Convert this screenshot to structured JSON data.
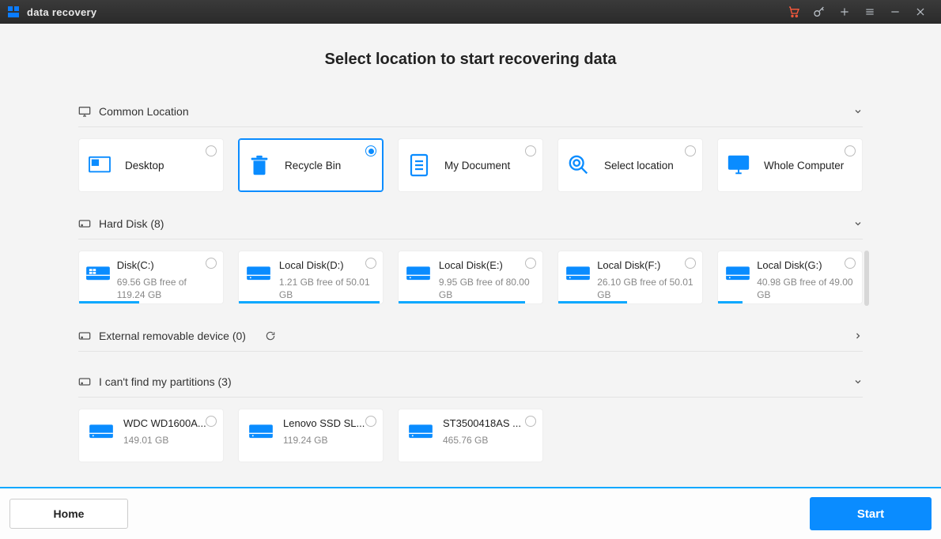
{
  "app": {
    "title": "data recovery"
  },
  "page": {
    "heading": "Select location to start recovering data"
  },
  "section_common": {
    "label": "Common Location"
  },
  "common": [
    {
      "label": "Desktop"
    },
    {
      "label": "Recycle Bin"
    },
    {
      "label": "My Document"
    },
    {
      "label": "Select location"
    },
    {
      "label": "Whole Computer"
    }
  ],
  "section_hdd": {
    "label": "Hard Disk (8)"
  },
  "hdd": [
    {
      "name": "Disk(C:)",
      "info": "69.56 GB  free of 119.24 GB",
      "pct": 42
    },
    {
      "name": "Local Disk(D:)",
      "info": "1.21 GB  free of 50.01 GB",
      "pct": 98
    },
    {
      "name": "Local Disk(E:)",
      "info": "9.95 GB  free of 80.00 GB",
      "pct": 88
    },
    {
      "name": "Local Disk(F:)",
      "info": "26.10 GB  free of 50.01 GB",
      "pct": 48
    },
    {
      "name": "Local Disk(G:)",
      "info": "40.98 GB  free of 49.00 GB",
      "pct": 17
    }
  ],
  "section_ext": {
    "label": "External removable device (0)"
  },
  "section_lost": {
    "label": "I can't find my partitions (3)"
  },
  "lost": [
    {
      "name": "WDC WD1600A...",
      "info": "149.01 GB"
    },
    {
      "name": "Lenovo SSD SL...",
      "info": "119.24 GB"
    },
    {
      "name": "ST3500418AS ...",
      "info": "465.76 GB"
    }
  ],
  "footer": {
    "home": "Home",
    "start": "Start"
  },
  "colors": {
    "accent": "#0a8cff"
  }
}
